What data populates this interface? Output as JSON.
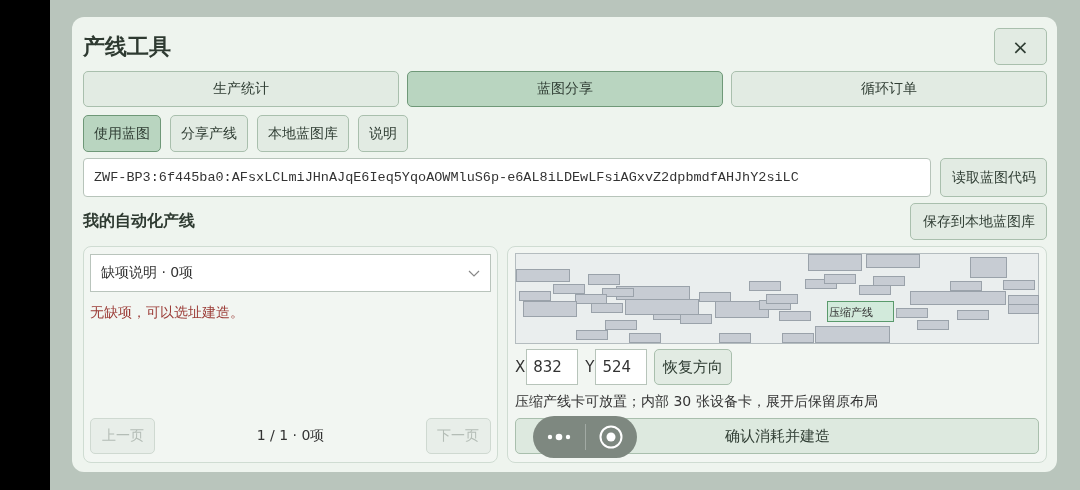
{
  "dialog": {
    "title": "产线工具",
    "close_label": "×"
  },
  "tabs": [
    {
      "label": "生产统计",
      "selected": false
    },
    {
      "label": "蓝图分享",
      "selected": true
    },
    {
      "label": "循环订单",
      "selected": false
    }
  ],
  "subtabs": [
    {
      "label": "使用蓝图",
      "selected": true
    },
    {
      "label": "分享产线",
      "selected": false
    },
    {
      "label": "本地蓝图库",
      "selected": false
    },
    {
      "label": "说明",
      "selected": false
    }
  ],
  "blueprint_code": {
    "value": "ZWF-BP3:6f445ba0:AFsxLCLmiJHnAJqE6Ieq5YqoAOWMluS6p-e6AL8iLDEwLFsiAGxvZ2dpbmdfAHJhY2siLC",
    "button": "读取蓝图代码"
  },
  "section": {
    "title": "我的自动化产线",
    "button": "保存到本地蓝图库"
  },
  "missing_panel": {
    "dropdown": "缺项说明 · 0项",
    "message": "无缺项，可以选址建造。",
    "prev_button": {
      "label": "上一页",
      "disabled": true
    },
    "page_info": "1 / 1 · 0项",
    "next_button": {
      "label": "下一页",
      "disabled": true
    }
  },
  "placement_panel": {
    "map_card_label": "压缩产线",
    "x_label": "X",
    "x_value": "832",
    "y_label": "Y",
    "y_value": "524",
    "reset_button": "恢复方向",
    "note": "压缩产线卡可放置；内部 30 张设备卡，展开后保留原布局",
    "confirm_button": "确认消耗并建造"
  }
}
